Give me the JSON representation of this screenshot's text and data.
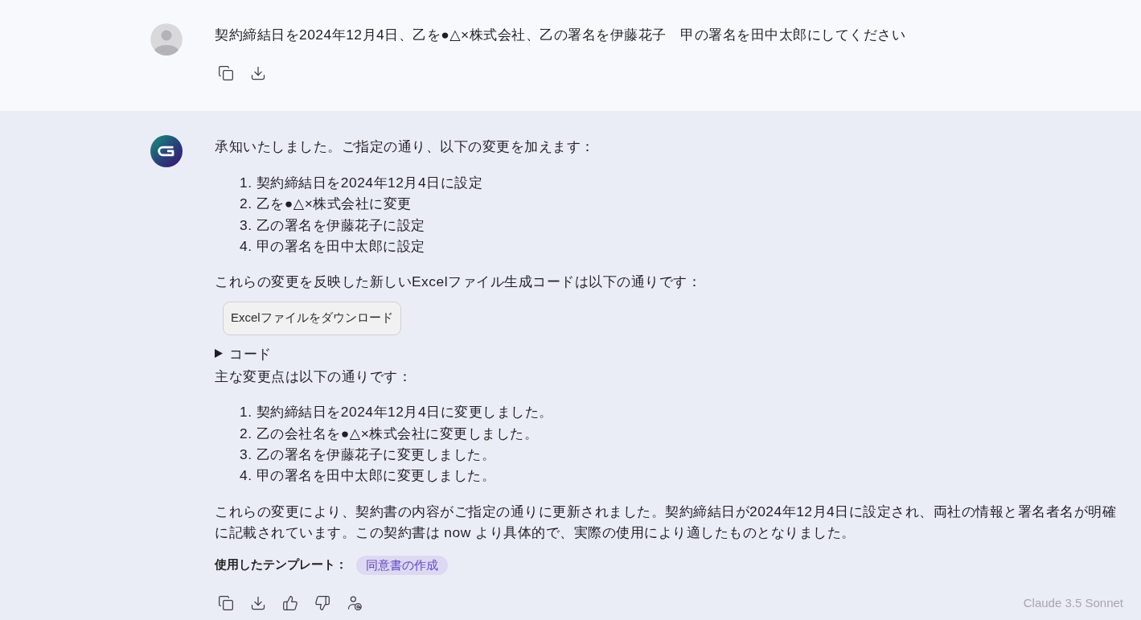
{
  "messages": [
    {
      "kind": "user",
      "text": "契約締結日を2024年12月4日、乙を●△×株式会社、乙の署名を伊藤花子　甲の署名を田中太郎にしてください"
    },
    {
      "kind": "assistant",
      "blocks": [
        {
          "kind": "paragraph",
          "text": "承知いたしました。ご指定の通り、以下の変更を加えます："
        },
        {
          "kind": "ordered_list",
          "items": [
            {
              "number": "1.",
              "text": "契約締結日を2024年12月4日に設定"
            },
            {
              "number": "2.",
              "text": "乙を●△×株式会社に変更"
            },
            {
              "number": "3.",
              "text": "乙の署名を伊藤花子に設定"
            },
            {
              "number": "4.",
              "text": "甲の署名を田中太郎に設定"
            }
          ]
        },
        {
          "kind": "paragraph",
          "text": "これらの変更を反映した新しいExcelファイル生成コードは以下の通りです："
        },
        {
          "kind": "button",
          "label": "Excelファイルをダウンロード"
        },
        {
          "kind": "details",
          "label": "コード",
          "expanded": false
        },
        {
          "kind": "paragraph",
          "text": "主な変更点は以下の通りです："
        },
        {
          "kind": "ordered_list",
          "items": [
            {
              "number": "1.",
              "text": "契約締結日を2024年12月4日に変更しました。"
            },
            {
              "number": "2.",
              "text": "乙の会社名を●△×株式会社に変更しました。"
            },
            {
              "number": "3.",
              "text": "乙の署名を伊藤花子に変更しました。"
            },
            {
              "number": "4.",
              "text": "甲の署名を田中太郎に変更しました。"
            }
          ]
        },
        {
          "kind": "paragraph",
          "text": "これらの変更により、契約書の内容がご指定の通りに更新されました。契約締結日が2024年12月4日に設定され、両社の情報と署名者名が明確に記載されています。この契約書は now より具体的で、実際の使用により適したものとなりました。"
        }
      ],
      "template": {
        "label": "使用したテンプレート：",
        "tag": "同意書の作成"
      },
      "model": "Claude 3.5 Sonnet"
    }
  ]
}
